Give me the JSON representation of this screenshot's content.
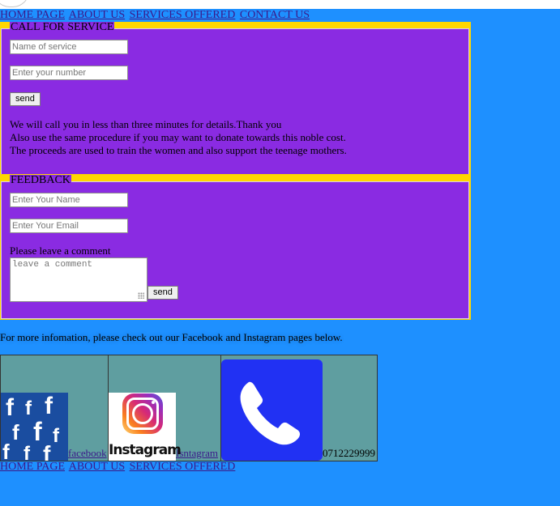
{
  "nav_top": [
    "HOME PAGE",
    "ABOUT US",
    "SERVICES OFFERED",
    "CONTACT US"
  ],
  "nav_bottom": [
    "HOME PAGE",
    "ABOUT US",
    "SERVICES OFFERED"
  ],
  "call_service": {
    "legend": "CALL FOR SERVICE",
    "service_placeholder": "Name of service",
    "number_placeholder": "Enter your number",
    "send_label": "send",
    "message_lines": [
      "We will call you in less than three minutes for details.Thank you",
      "Also use the same procedure if you may want to donate towards this noble cost.",
      "The proceeds are used to train the women and also support the teenage mothers."
    ]
  },
  "feedback": {
    "legend": "FEEDBACK",
    "name_placeholder": "Enter Your Name",
    "email_placeholder": "Enter Your Email",
    "comment_label": "Please leave a comment",
    "comment_placeholder": "leave a comment",
    "send_label": "send"
  },
  "info_text": "For more infomation, please check out our Facebook and Instagram pages below.",
  "social": {
    "facebook_link": "facebook",
    "instagram_link": "Isntagram",
    "instagram_logo_text": "Instagram",
    "facebook_logo_glyph": "f",
    "phone_number": "0712229999"
  },
  "colors": {
    "page_bg": "#1e90ff",
    "panel_bg": "#8a2be2",
    "panel_border": "#ffd700",
    "social_bg": "#5f9ea0",
    "phone_icon_bg": "#2131f3"
  }
}
